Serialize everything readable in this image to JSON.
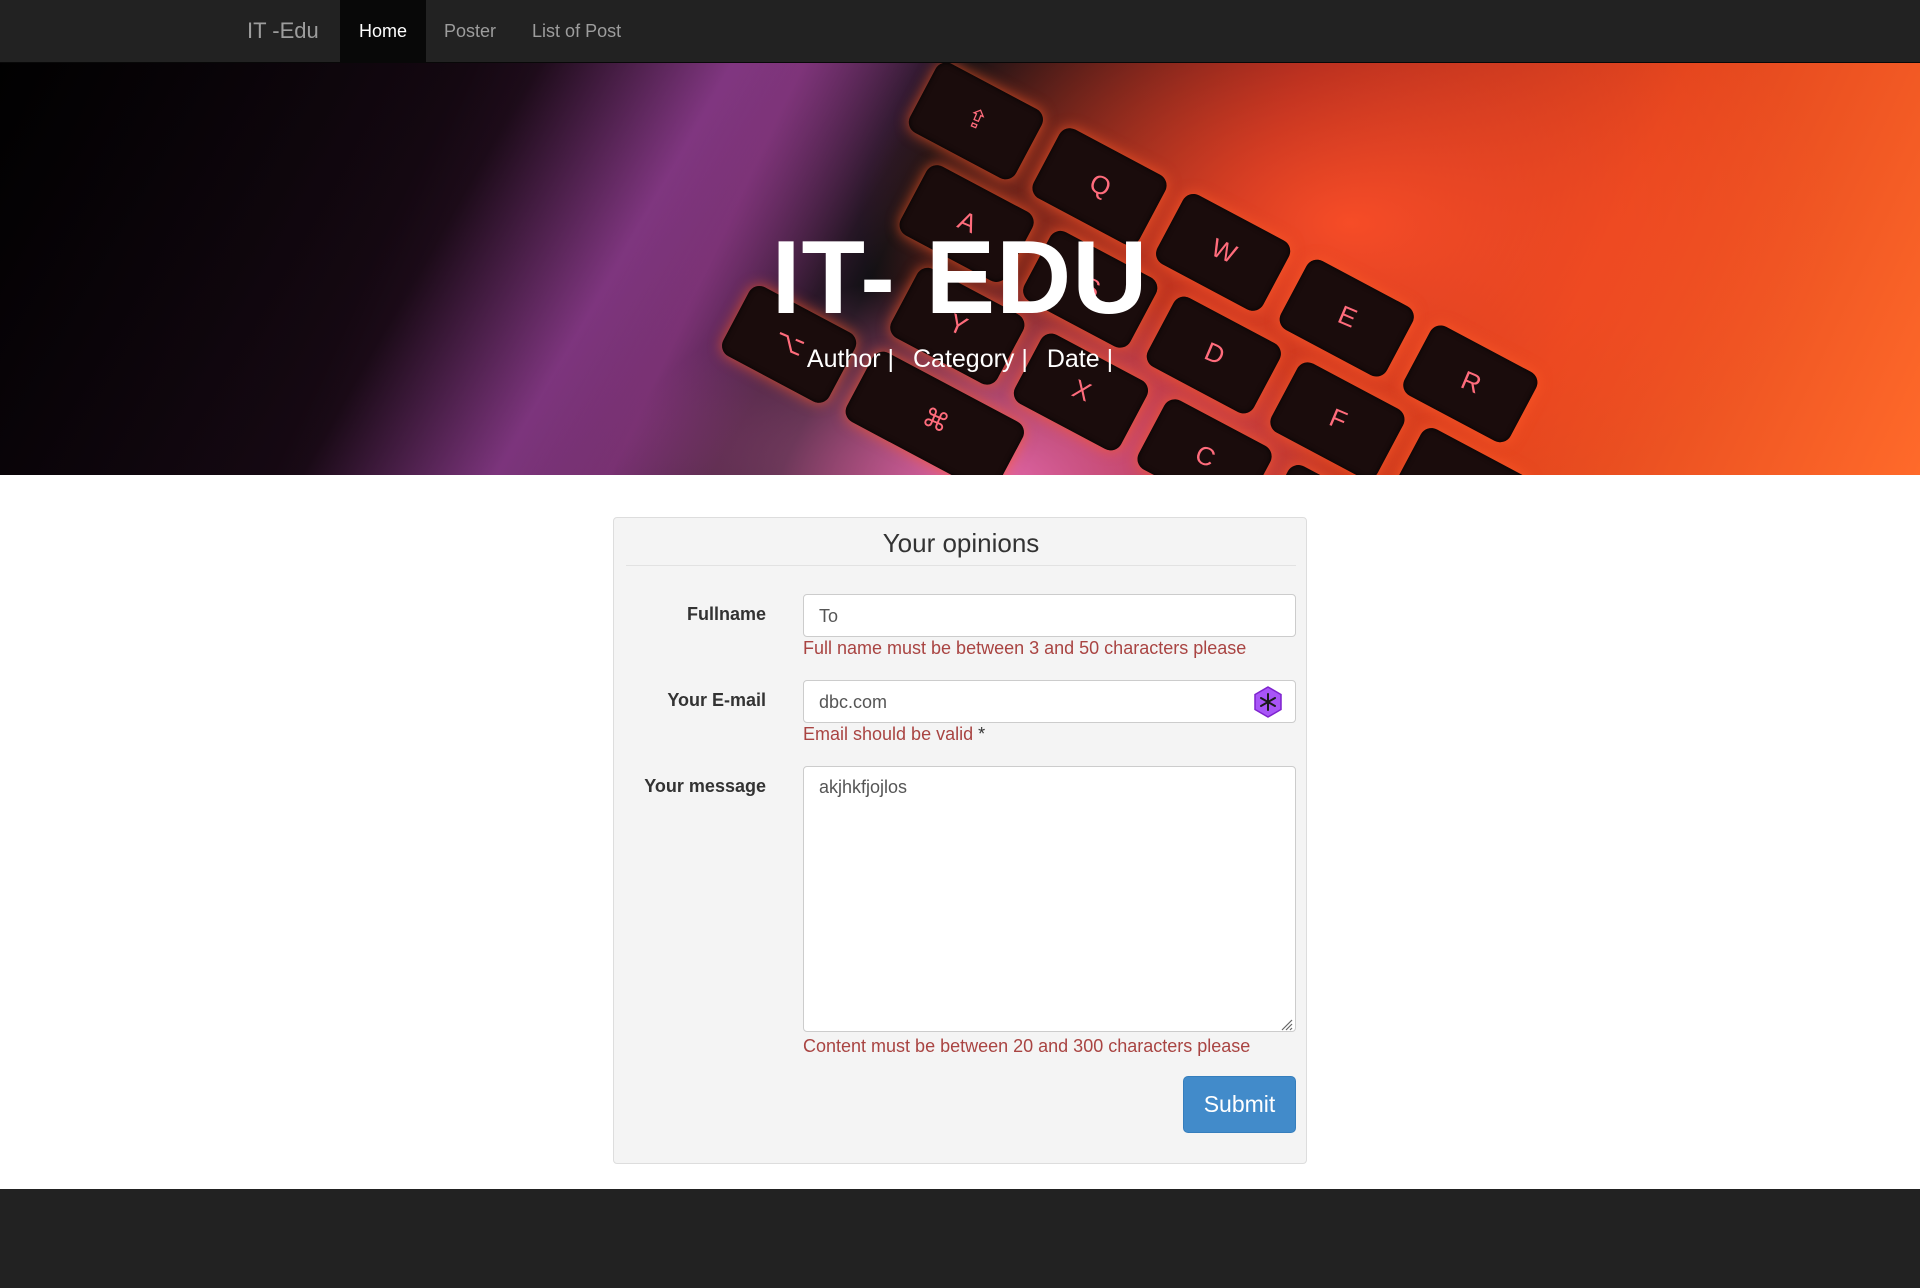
{
  "navbar": {
    "brand": "IT -Edu",
    "items": [
      {
        "label": "Home",
        "active": true
      },
      {
        "label": "Poster",
        "active": false
      },
      {
        "label": "List of Post",
        "active": false
      }
    ]
  },
  "hero": {
    "title": "IT- EDU",
    "meta": [
      "Author |",
      "Category |",
      "Date |"
    ]
  },
  "form": {
    "title": "Your opinions",
    "fullname": {
      "label": "Fullname",
      "value": "To",
      "error": "Full name must be between 3 and 50 characters please"
    },
    "email": {
      "label": "Your E-mail",
      "value": "dbc.com",
      "error": "Email should be valid",
      "error_mark": "*"
    },
    "message": {
      "label": "Your message",
      "value": "akjhkfjojlos",
      "error": "Content must be between 20 and 300 characters please"
    },
    "submit_label": "Submit"
  },
  "icons": {
    "email_extension": "hexagon-asterisk-icon"
  },
  "colors": {
    "navbar": "#222222",
    "error": "#a94442",
    "primary": "#428bca",
    "extension": "#a855f7"
  }
}
